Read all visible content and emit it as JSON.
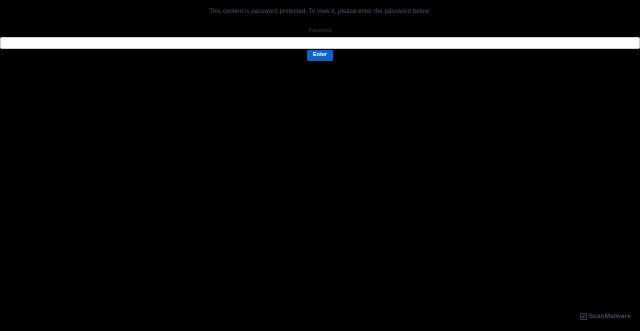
{
  "prompt": {
    "message": "This content is password protected. To view it, please enter the password below:"
  },
  "form": {
    "password_label": "Password",
    "password_value": "",
    "enter_label": "Enter"
  },
  "branding": {
    "name": "ScanMalware",
    "logo_icon": "scanmalware-logo-icon"
  },
  "colors": {
    "background": "#000000",
    "accent": "#0e63c8",
    "message_text": "#4a5a78",
    "brand_text": "#56678a"
  }
}
